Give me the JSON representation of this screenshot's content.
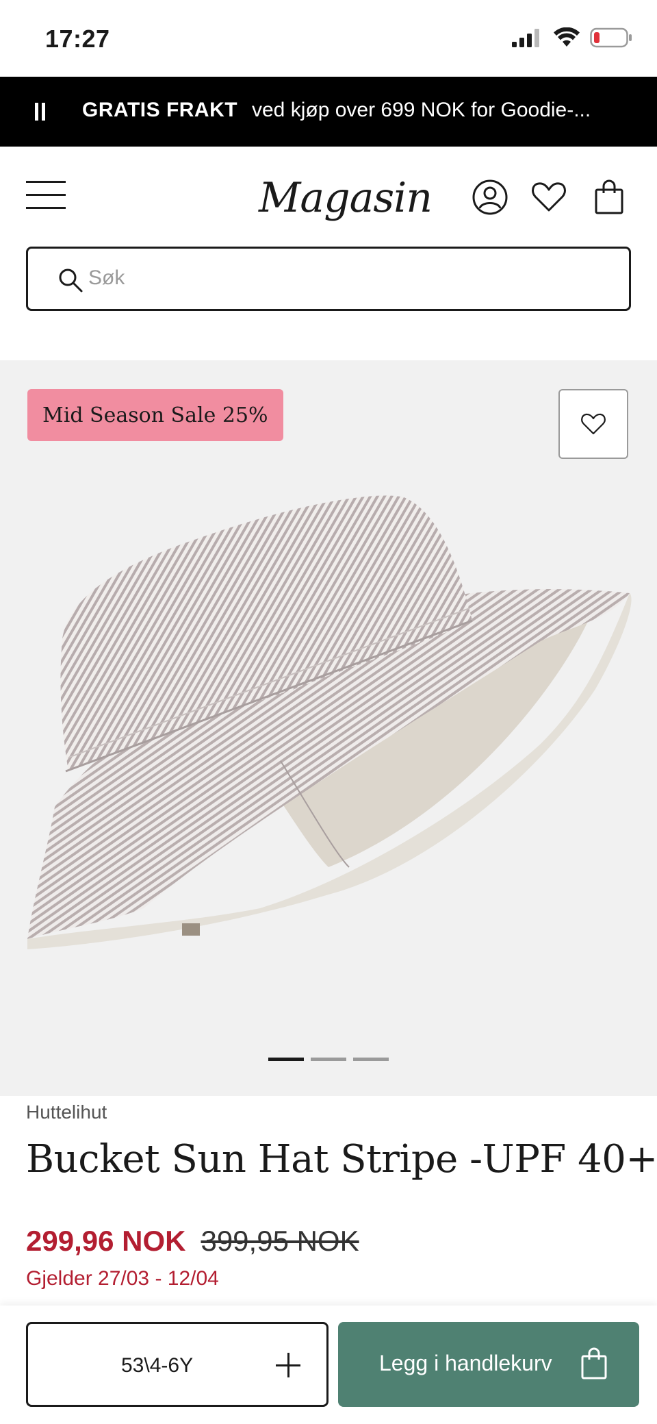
{
  "status_bar": {
    "time": "17:27"
  },
  "promo": {
    "strong": "GRATIS FRAKT",
    "rest": "ved kjøp over 699 NOK for Goodie-..."
  },
  "header": {
    "logo": "Magasin"
  },
  "search": {
    "placeholder": "Søk"
  },
  "gallery": {
    "badge": "Mid Season Sale 25%",
    "image_count": 3,
    "active_image": 1
  },
  "product": {
    "brand": "Huttelihut",
    "title": "Bucket Sun Hat Stripe -UPF 40+",
    "price_now": "299,96 NOK",
    "price_old": "399,95 NOK",
    "validity": "Gjelder 27/03 - 12/04"
  },
  "purchase": {
    "size": "53\\4-6Y",
    "add_to_cart": "Legg i handlekurv"
  },
  "colors": {
    "promo_bg": "#000000",
    "sale_badge": "#f18da0",
    "price_red": "#b31e31",
    "cart_green": "#4f8172",
    "gallery_bg": "#f1f1f1"
  },
  "icons": {
    "header": [
      "menu-icon",
      "account-icon",
      "heart-icon",
      "bag-icon"
    ],
    "search": "search-icon",
    "wishlist": "heart-icon",
    "cart": "bag-icon"
  }
}
